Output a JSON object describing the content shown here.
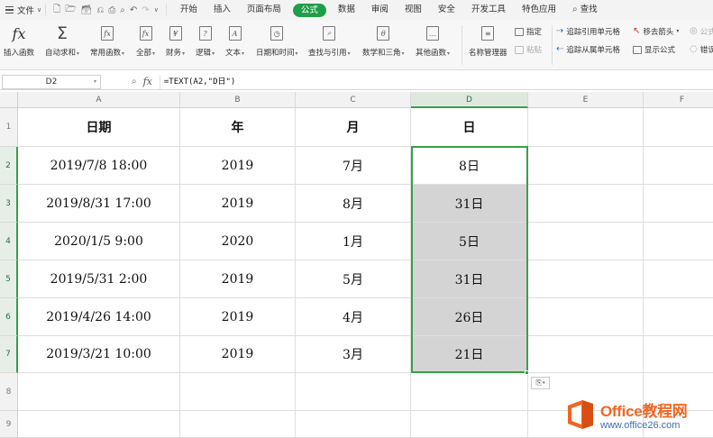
{
  "menubar": {
    "file_label": "文件",
    "quick_access_icons": [
      "new-file-icon",
      "open-folder-icon",
      "save-icon",
      "redo-format-icon",
      "print-icon",
      "print-preview-icon",
      "undo-icon",
      "redo-icon",
      "more-icon"
    ],
    "tabs": [
      {
        "label": "开始",
        "active": false
      },
      {
        "label": "插入",
        "active": false
      },
      {
        "label": "页面布局",
        "active": false
      },
      {
        "label": "公式",
        "active": true
      },
      {
        "label": "数据",
        "active": false
      },
      {
        "label": "审阅",
        "active": false
      },
      {
        "label": "视图",
        "active": false
      },
      {
        "label": "安全",
        "active": false
      },
      {
        "label": "开发工具",
        "active": false
      },
      {
        "label": "特色应用",
        "active": false
      }
    ],
    "search_label": "查找"
  },
  "ribbon": {
    "insert_function": "插入函数",
    "autosum": "自动求和",
    "common_functions": "常用函数",
    "all": "全部",
    "finance": "财务",
    "logic": "逻辑",
    "text": "文本",
    "datetime": "日期和时间",
    "lookup": "查找与引用",
    "math": "数学和三角",
    "other": "其他函数",
    "name_manager": "名称管理器",
    "specify": "指定",
    "paste": "粘贴",
    "trace_precedents": "追踪引用单元格",
    "trace_dependents": "追踪从属单元格",
    "remove_arrows": "移去箭头",
    "show_formulas": "显示公式",
    "formula_eval": "公式",
    "error_check": "错误"
  },
  "formula_bar": {
    "name_box": "D2",
    "formula": "=TEXT(A2,\"D日\")"
  },
  "sheet": {
    "columns": [
      "A",
      "B",
      "C",
      "D",
      "E",
      "F"
    ],
    "row_numbers": [
      "1",
      "2",
      "3",
      "4",
      "5",
      "6",
      "7",
      "8",
      "9"
    ],
    "headers": [
      "日期",
      "年",
      "月",
      "日"
    ],
    "rows": [
      [
        "2019/7/8  18:00",
        "2019",
        "7月",
        "8日"
      ],
      [
        "2019/8/31  17:00",
        "2019",
        "8月",
        "31日"
      ],
      [
        "2020/1/5  9:00",
        "2020",
        "1月",
        "5日"
      ],
      [
        "2019/5/31  2:00",
        "2019",
        "5月",
        "31日"
      ],
      [
        "2019/4/26  14:00",
        "2019",
        "4月",
        "26日"
      ],
      [
        "2019/3/21  10:00",
        "2019",
        "3月",
        "21日"
      ]
    ],
    "selected_column": "D",
    "selected_rows": [
      "2",
      "3",
      "4",
      "5",
      "6",
      "7"
    ]
  },
  "watermark": {
    "brand": "Office教程网",
    "url": "www.office26.com"
  },
  "colors": {
    "accent_green": "#1f9e48",
    "selection_green": "#37a04a",
    "watermark_orange": "#f26522",
    "watermark_blue": "#3b6fb6"
  }
}
